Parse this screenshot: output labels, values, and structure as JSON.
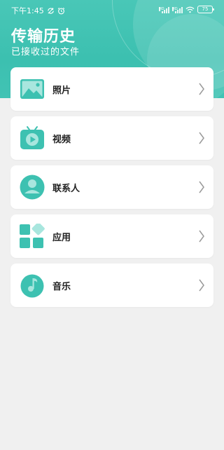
{
  "status_bar": {
    "time": "下午1:45",
    "battery": "75"
  },
  "header": {
    "title": "传输历史",
    "subtitle": "已接收过的文件"
  },
  "colors": {
    "accent": "#3dc1b1",
    "accent_light": "#9de3da",
    "background": "#f0f0f0",
    "card": "#ffffff"
  },
  "items": [
    {
      "label": "照片",
      "icon": "photo-icon"
    },
    {
      "label": "视频",
      "icon": "video-icon"
    },
    {
      "label": "联系人",
      "icon": "contact-icon"
    },
    {
      "label": "应用",
      "icon": "apps-icon"
    },
    {
      "label": "音乐",
      "icon": "music-icon"
    }
  ]
}
